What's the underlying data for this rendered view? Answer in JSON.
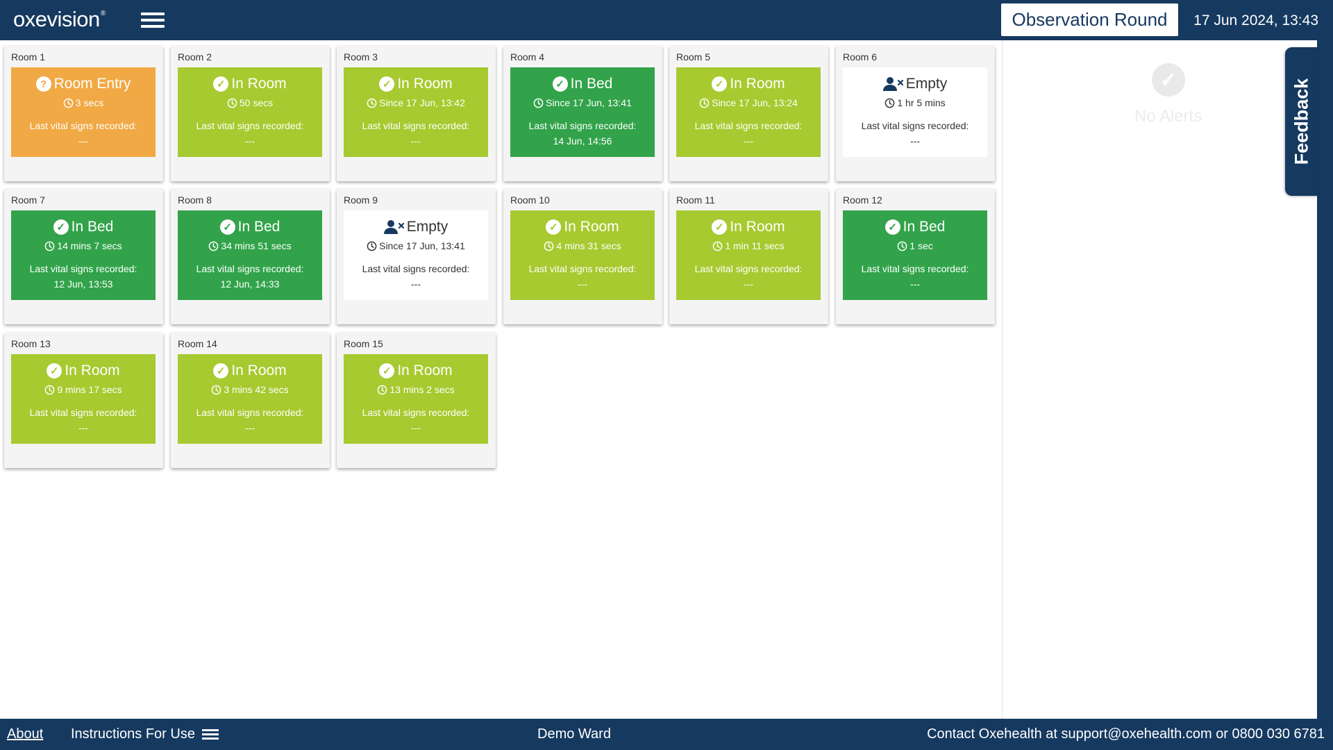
{
  "header": {
    "logo_text": "oxevision",
    "logo_mark": "®",
    "observation_button_label": "Observation Round",
    "datetime": "17 Jun 2024, 13:43"
  },
  "vitals_label": "Last vital signs recorded:",
  "rooms": [
    {
      "name": "Room 1",
      "status": "Room Entry",
      "state": "orange",
      "icon": "question-icon",
      "duration": "3 secs",
      "vitals": "---"
    },
    {
      "name": "Room 2",
      "status": "In Room",
      "state": "lime",
      "icon": "check-icon",
      "duration": "50 secs",
      "vitals": "---"
    },
    {
      "name": "Room 3",
      "status": "In Room",
      "state": "lime",
      "icon": "check-icon",
      "duration": "Since 17 Jun, 13:42",
      "vitals": "---"
    },
    {
      "name": "Room 4",
      "status": "In Bed",
      "state": "green",
      "icon": "check-icon",
      "duration": "Since 17 Jun, 13:41",
      "vitals": "14 Jun, 14:56"
    },
    {
      "name": "Room 5",
      "status": "In Room",
      "state": "lime",
      "icon": "check-icon",
      "duration": "Since 17 Jun, 13:24",
      "vitals": "---"
    },
    {
      "name": "Room 6",
      "status": "Empty",
      "state": "empty",
      "icon": "person-x-icon",
      "duration": "1 hr 5 mins",
      "vitals": "---"
    },
    {
      "name": "Room 7",
      "status": "In Bed",
      "state": "green",
      "icon": "check-icon",
      "duration": "14 mins 7 secs",
      "vitals": "12 Jun, 13:53"
    },
    {
      "name": "Room 8",
      "status": "In Bed",
      "state": "green",
      "icon": "check-icon",
      "duration": "34 mins 51 secs",
      "vitals": "12 Jun, 14:33"
    },
    {
      "name": "Room 9",
      "status": "Empty",
      "state": "empty",
      "icon": "person-x-icon",
      "duration": "Since 17 Jun, 13:41",
      "vitals": "---"
    },
    {
      "name": "Room 10",
      "status": "In Room",
      "state": "lime",
      "icon": "check-icon",
      "duration": "4 mins 31 secs",
      "vitals": "---"
    },
    {
      "name": "Room 11",
      "status": "In Room",
      "state": "lime",
      "icon": "check-icon",
      "duration": "1 min 11 secs",
      "vitals": "---"
    },
    {
      "name": "Room 12",
      "status": "In Bed",
      "state": "green",
      "icon": "check-icon",
      "duration": "1 sec",
      "vitals": "---"
    },
    {
      "name": "Room 13",
      "status": "In Room",
      "state": "lime",
      "icon": "check-icon",
      "duration": "9 mins 17 secs",
      "vitals": "---"
    },
    {
      "name": "Room 14",
      "status": "In Room",
      "state": "lime",
      "icon": "check-icon",
      "duration": "3 mins 42 secs",
      "vitals": "---"
    },
    {
      "name": "Room 15",
      "status": "In Room",
      "state": "lime",
      "icon": "check-icon",
      "duration": "13 mins 2 secs",
      "vitals": "---"
    }
  ],
  "alerts": {
    "empty_text": "No Alerts"
  },
  "feedback_label": "Feedback",
  "footer": {
    "about_label": "About",
    "instructions_label": "Instructions For Use",
    "ward_name": "Demo Ward",
    "contact_text": "Contact Oxehealth at support@oxehealth.com or 0800 030 6781"
  },
  "colors": {
    "navy": "#163960",
    "room_entry": "#f0a944",
    "in_room": "#a6ca2f",
    "in_bed": "#32a34a",
    "empty": "#ffffff"
  }
}
